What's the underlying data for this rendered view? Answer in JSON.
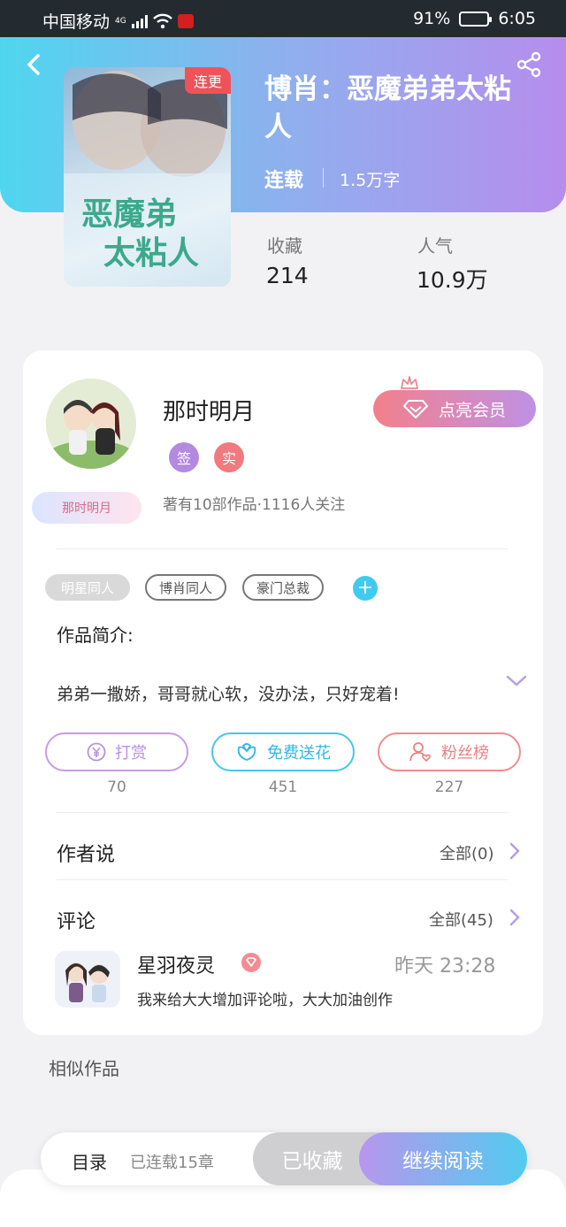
{
  "status_bar": {
    "carrier": "中国移动",
    "network": "4G",
    "battery": "91%",
    "battery_fraction": 0.91,
    "time": "6:05"
  },
  "book": {
    "badge": "连更",
    "title": "博肖：恶魔弟弟太粘人",
    "status": "连载",
    "words": "1.5万字",
    "stats": [
      {
        "label": "收藏",
        "value": "214"
      },
      {
        "label": "人气",
        "value": "10.9万"
      }
    ]
  },
  "author": {
    "name": "那时明月",
    "badge_label": "那时明月",
    "badges": [
      "签",
      "实"
    ],
    "stats": "著有10部作品·1116人关注",
    "vip_button": "点亮会员"
  },
  "tags": [
    "明星同人",
    "博肖同人",
    "豪门总裁"
  ],
  "intro": {
    "label": "作品简介:",
    "text": "弟弟一撒娇，哥哥就心软，没办法，只好宠着!"
  },
  "actions": [
    {
      "label": "打赏",
      "count": "70",
      "color": "#c79be6"
    },
    {
      "label": "免费送花",
      "count": "451",
      "color": "#46c6ec"
    },
    {
      "label": "粉丝榜",
      "count": "227",
      "color": "#f08c8c"
    }
  ],
  "author_says": {
    "title": "作者说",
    "link": "全部(0)"
  },
  "comments": {
    "title": "评论",
    "link": "全部(45)",
    "items": [
      {
        "user": "星羽夜灵",
        "time": "昨天 23:28",
        "text": "我来给大大增加评论啦，大大加油创作"
      }
    ]
  },
  "similar": {
    "title": "相似作品"
  },
  "bottom": {
    "toc_label": "目录",
    "toc_sub": "已连载15章",
    "fav": "已收藏",
    "read": "继续阅读"
  }
}
